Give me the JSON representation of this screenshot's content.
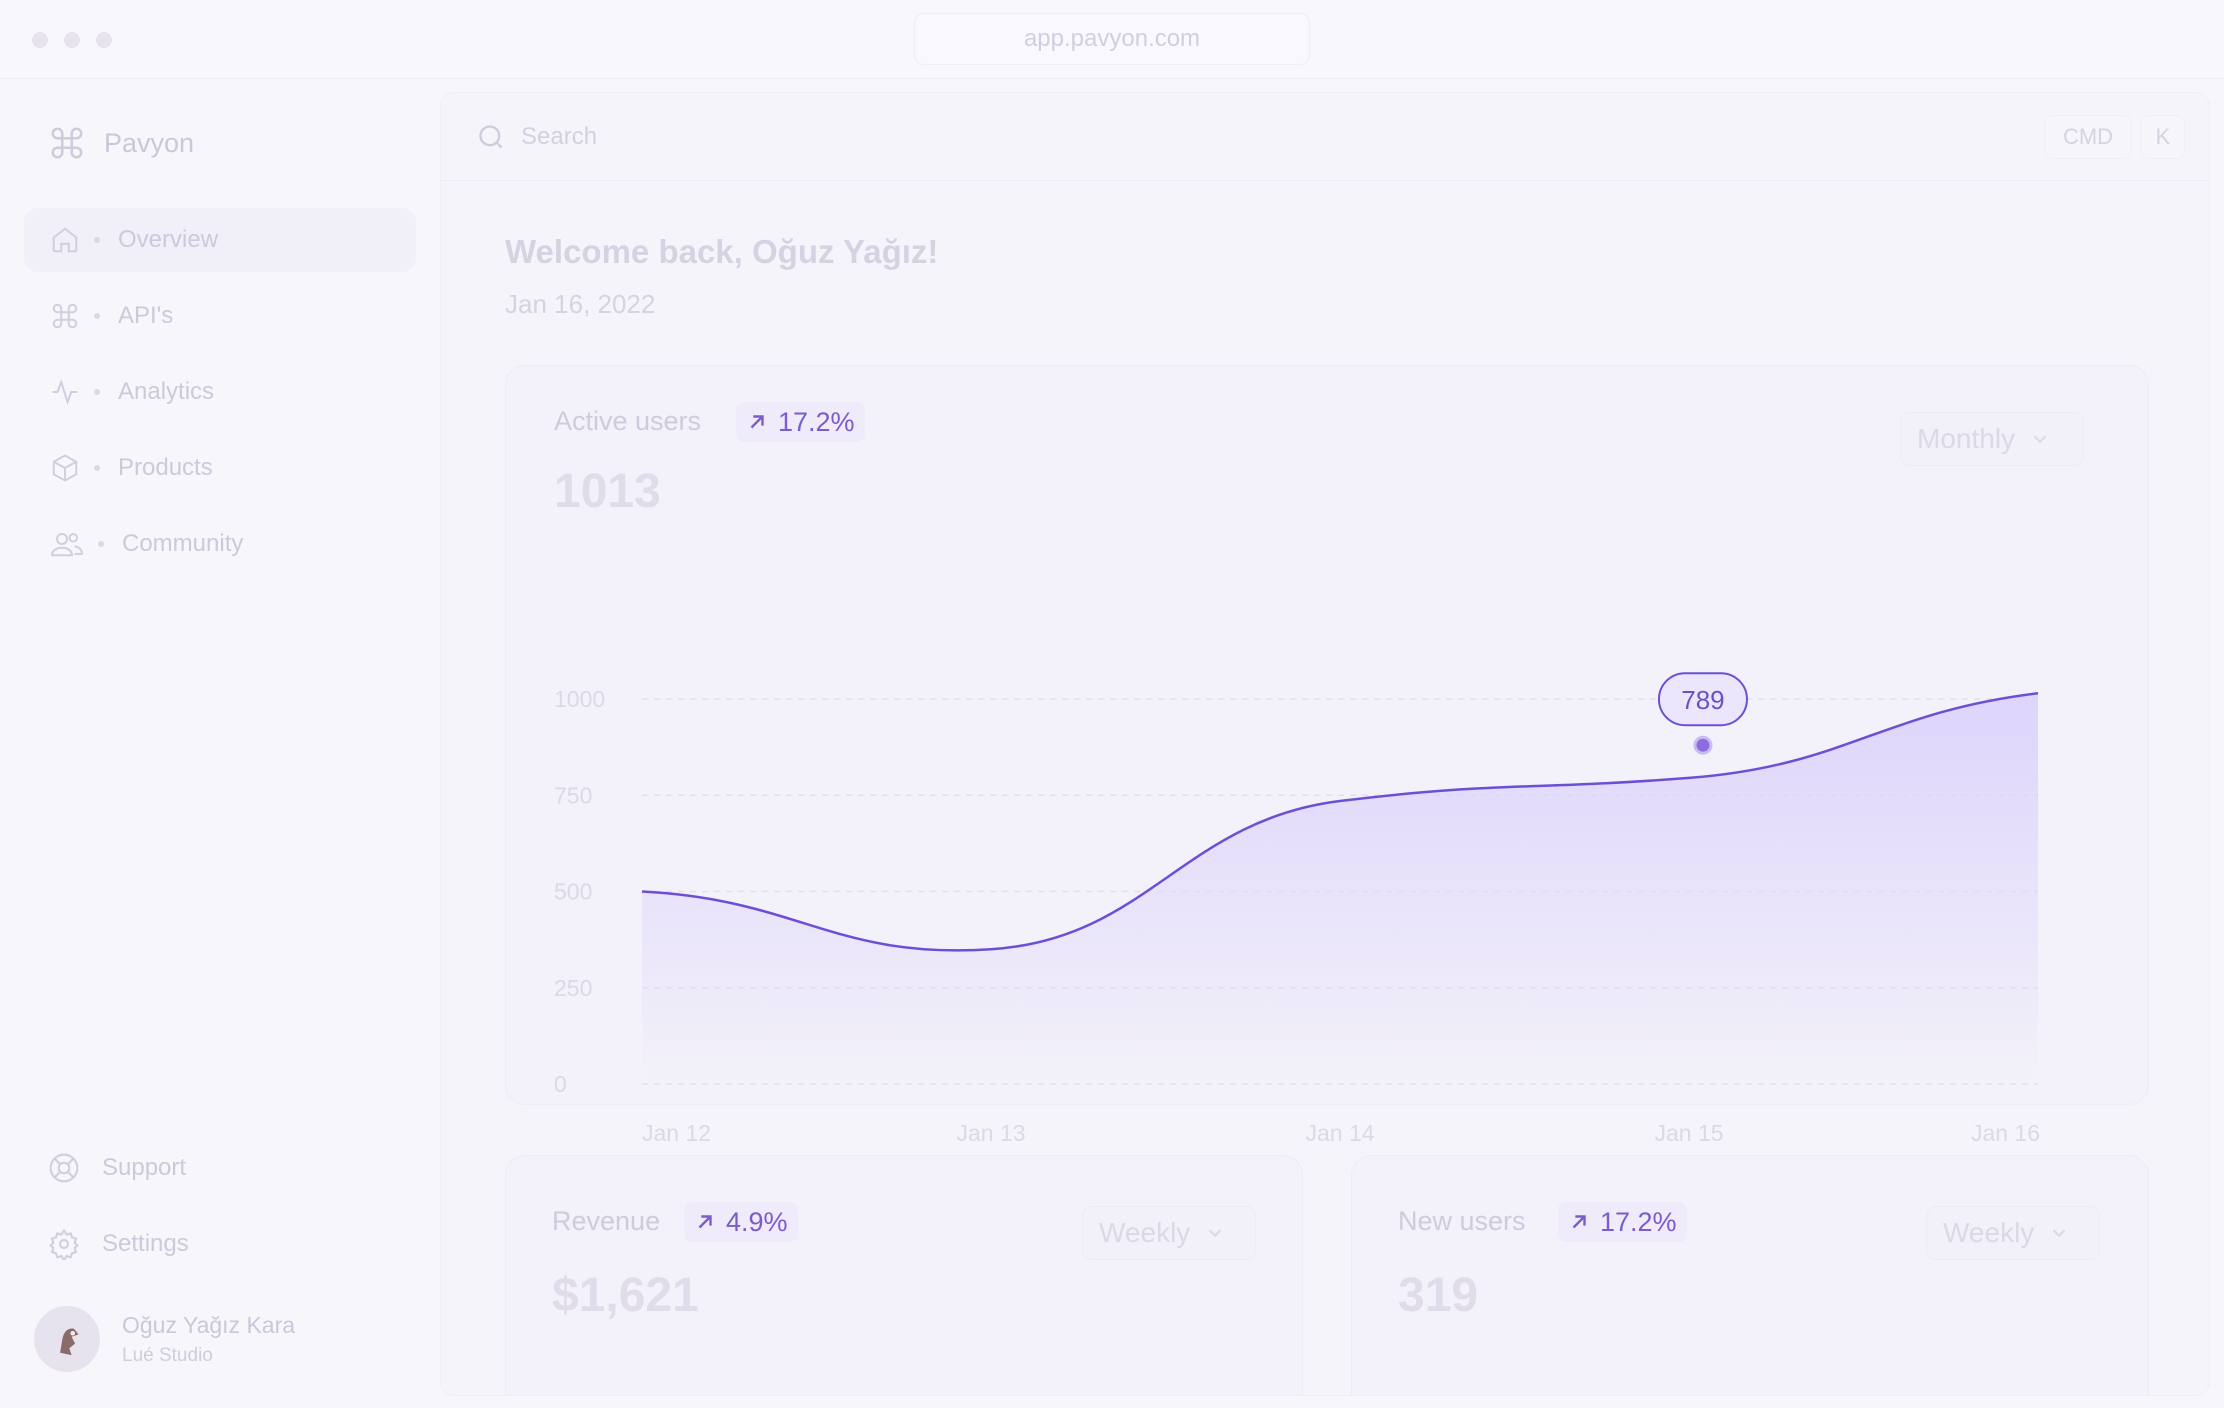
{
  "window": {
    "url": "app.pavyon.com"
  },
  "brand": {
    "name": "Pavyon"
  },
  "sidebar": {
    "items": [
      {
        "label": "Overview",
        "icon": "home-icon",
        "active": true
      },
      {
        "label": "API's",
        "icon": "command-icon",
        "active": false
      },
      {
        "label": "Analytics",
        "icon": "activity-icon",
        "active": false
      },
      {
        "label": "Products",
        "icon": "box-icon",
        "active": false
      },
      {
        "label": "Community",
        "icon": "users-icon",
        "active": false
      }
    ],
    "footer": [
      {
        "label": "Support",
        "icon": "lifebuoy-icon"
      },
      {
        "label": "Settings",
        "icon": "gear-icon"
      }
    ],
    "user": {
      "name": "Oğuz Yağız Kara",
      "company": "Lué Studio"
    }
  },
  "search": {
    "placeholder": "Search",
    "shortcut_keys": [
      "CMD",
      "K"
    ]
  },
  "header": {
    "welcome": "Welcome back, Oğuz Yağız!",
    "date": "Jan 16, 2022"
  },
  "active_users_card": {
    "title": "Active users",
    "change": "17.2%",
    "change_icon": "arrow-up-right-icon",
    "value": "1013",
    "period": "Monthly"
  },
  "revenue_card": {
    "title": "Revenue",
    "change": "4.9%",
    "value": "$1,621",
    "period": "Weekly"
  },
  "new_users_card": {
    "title": "New users",
    "change": "17.2%",
    "value": "319",
    "period": "Weekly"
  },
  "colors": {
    "accent": "#6d4fd6",
    "area_top": "#dcd3fb",
    "text_muted": "#cfcbdd"
  },
  "chart_data": {
    "type": "area",
    "x": [
      "Jan 12",
      "Jan 13",
      "Jan 14",
      "Jan 15",
      "Jan 16"
    ],
    "x_ticks": [
      "Jan 12",
      "Jan 13",
      "Jan 14",
      "Jan 15",
      "Jan 16"
    ],
    "y_ticks": [
      "0",
      "250",
      "500",
      "750",
      "1000"
    ],
    "ylim": [
      0,
      1000
    ],
    "series": [
      {
        "points": [
          {
            "x": "Jan 12",
            "y": 500
          },
          {
            "x": "Jan 13",
            "y": 350
          },
          {
            "x": "Jan 14",
            "y": 735
          },
          {
            "x": "Jan 15",
            "y": 795
          },
          {
            "x": "Jan 16",
            "y": 1015
          }
        ]
      }
    ],
    "highlight": {
      "x_fraction": 0.76,
      "y": 880,
      "label": "789"
    },
    "grid": "dashed horizontal"
  }
}
